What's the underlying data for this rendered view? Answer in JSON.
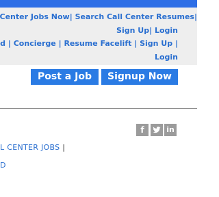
{
  "nav": {
    "line1": {
      "employers_jobs": "Center Jobs Now",
      "sep1": "|",
      "search_resumes": "Search Call Center Resumes",
      "sep2": "|"
    },
    "line2": {
      "signup": "Sign Up",
      "sep": "|",
      "login": "Login"
    },
    "line3": {
      "upload": "Upload",
      "sep1": "|",
      "concierge": "Concierge",
      "sep2": "|",
      "facelift": "Resume Facelift",
      "sep3": "|",
      "signup": "Sign Up",
      "sep4": "|"
    },
    "line4": {
      "login": "Login"
    }
  },
  "cta": {
    "post_job": "Post a Job",
    "signup_now": "Signup Now"
  },
  "social": {
    "facebook": "f",
    "linkedin": "in",
    "icons": [
      "facebook-icon",
      "twitter-icon",
      "linkedin-icon"
    ]
  },
  "footer": {
    "link1": "L CENTER JOBS",
    "sep": "|",
    "link2": "D"
  },
  "colors": {
    "accent": "#2d6ee6",
    "link": "#2a6fd0",
    "button": "#2a7be4",
    "band": "#eeeeee",
    "social_gray": "#9b9b9b"
  }
}
